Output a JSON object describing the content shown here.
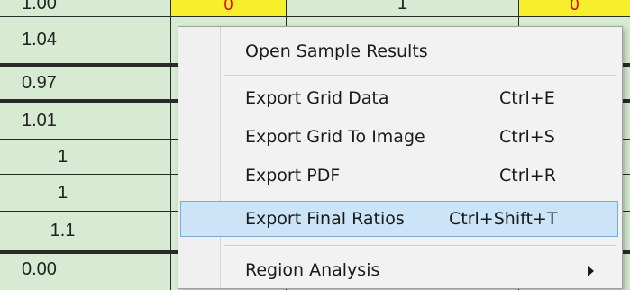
{
  "grid": {
    "top_row": {
      "col0": "1.00",
      "col1_red": "0",
      "col2": "1",
      "col3_red": "0"
    },
    "rows": [
      "1.04",
      "0.97",
      "1.01",
      "1",
      "1",
      "1.1",
      "0.00"
    ]
  },
  "menu": {
    "items": [
      {
        "label": "Open Sample Results",
        "shortcut": ""
      },
      {
        "label": "Export Grid Data",
        "shortcut": "Ctrl+E"
      },
      {
        "label": "Export Grid To Image",
        "shortcut": "Ctrl+S"
      },
      {
        "label": "Export PDF",
        "shortcut": "Ctrl+R"
      },
      {
        "label": "Export Final Ratios",
        "shortcut": "Ctrl+Shift+T"
      },
      {
        "label": "Region Analysis",
        "shortcut": ""
      }
    ],
    "highlighted_index": 4,
    "colors": {
      "highlight_bg": "#cce4f7",
      "highlight_border": "#7aa9dc",
      "grid_bg": "#d6ebd2",
      "yellow_cell": "#f7ef2a"
    }
  }
}
